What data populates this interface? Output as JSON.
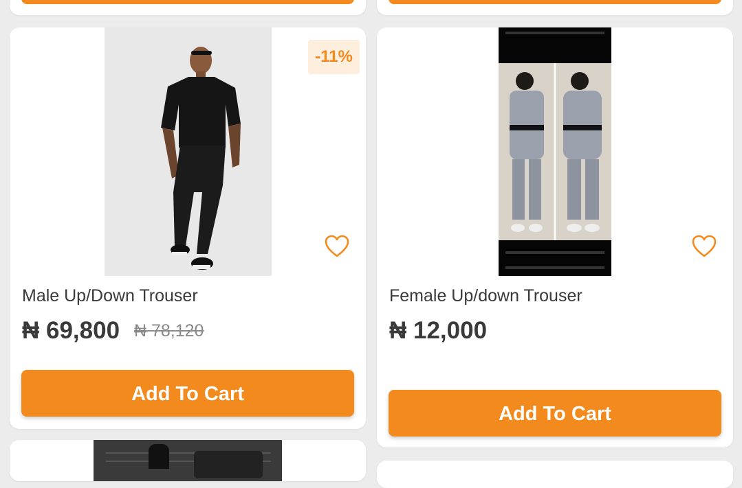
{
  "currency_symbol": "₦",
  "accent_color": "#f38a1d",
  "products": [
    {
      "name": "Male Up/Down Trouser",
      "price": "₦ 69,800",
      "old_price": "₦ 78,120",
      "discount_badge": "-11%",
      "add_to_cart_label": "Add To Cart",
      "favorite_icon": "heart-outline-icon"
    },
    {
      "name": "Female Up/down Trouser",
      "price": "₦ 12,000",
      "add_to_cart_label": "Add To Cart",
      "favorite_icon": "heart-outline-icon"
    }
  ]
}
